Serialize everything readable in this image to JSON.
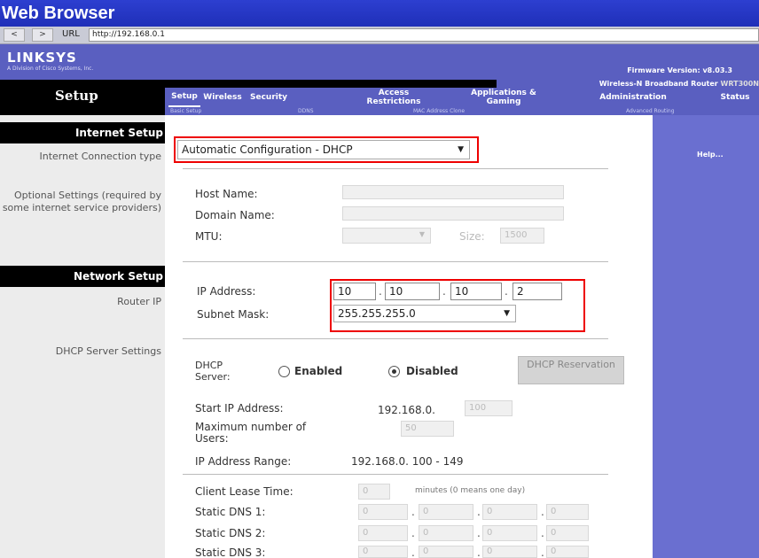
{
  "window": {
    "title": "Web Browser"
  },
  "urlbar": {
    "back": "<",
    "forward": ">",
    "label": "URL",
    "url": "http://192.168.0.1"
  },
  "header": {
    "logo": "LINKSYS",
    "logo_sub": "A Division of Cisco Systems, Inc.",
    "firmware": "Firmware Version: v8.03.3",
    "product": "Wireless-N Broadband Router",
    "model": "WRT300N"
  },
  "nav": {
    "section": "Setup",
    "tabs": [
      "Setup",
      "Wireless",
      "Security",
      "Access Restrictions",
      "Applications & Gaming",
      "Administration",
      "Status"
    ],
    "subtabs": [
      "Basic Setup",
      "DDNS",
      "MAC Address Clone",
      "Advanced Routing"
    ]
  },
  "left": {
    "internet_setup": "Internet Setup",
    "connection_type": "Internet Connection type",
    "optional": "Optional Settings (required by some internet service providers)",
    "network_setup": "Network Setup",
    "router_ip": "Router IP",
    "dhcp_settings": "DHCP Server Settings"
  },
  "right": {
    "help": "Help..."
  },
  "internet": {
    "connection_value": "Automatic Configuration - DHCP",
    "host_name_label": "Host Name:",
    "domain_name_label": "Domain Name:",
    "mtu_label": "MTU:",
    "size_label": "Size:",
    "size_value": "1500"
  },
  "router": {
    "ip_label": "IP Address:",
    "ip": [
      "10",
      "10",
      "10",
      "2"
    ],
    "mask_label": "Subnet Mask:",
    "mask_value": "255.255.255.0"
  },
  "dhcp": {
    "server_label": "DHCP Server:",
    "enabled": "Enabled",
    "disabled": "Disabled",
    "selected": "Disabled",
    "reservation": "DHCP Reservation",
    "start_label": "Start IP Address:",
    "start_prefix": "192.168.0.",
    "start_value": "100",
    "max_label": "Maximum number of Users:",
    "max_value": "50",
    "range_label": "IP Address Range:",
    "range_value": "192.168.0. 100 - 149",
    "lease_label": "Client Lease Time:",
    "lease_value": "0",
    "lease_hint": "minutes (0 means one day)",
    "dns": [
      {
        "label": "Static DNS 1:",
        "octets": [
          "0",
          "0",
          "0",
          "0"
        ]
      },
      {
        "label": "Static DNS 2:",
        "octets": [
          "0",
          "0",
          "0",
          "0"
        ]
      },
      {
        "label": "Static DNS 3:",
        "octets": [
          "0",
          "0",
          "0",
          "0"
        ]
      }
    ]
  }
}
